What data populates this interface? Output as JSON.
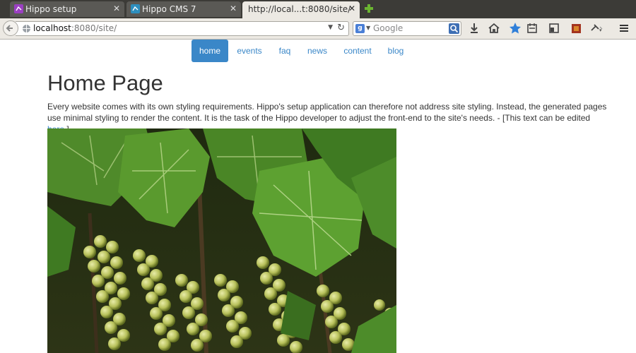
{
  "browser": {
    "tabs": [
      {
        "title": "Hippo setup",
        "active": false
      },
      {
        "title": "Hippo CMS 7",
        "active": false
      },
      {
        "title": "http://local...t:8080/site/",
        "active": true
      }
    ],
    "url_host": "localhost",
    "url_rest": ":8080/site/",
    "search_engine": "g-icon",
    "search_placeholder": "Google"
  },
  "site": {
    "nav": [
      {
        "label": "home",
        "active": true
      },
      {
        "label": "events",
        "active": false
      },
      {
        "label": "faq",
        "active": false
      },
      {
        "label": "news",
        "active": false
      },
      {
        "label": "content",
        "active": false
      },
      {
        "label": "blog",
        "active": false
      }
    ],
    "heading": "Home Page",
    "intro": "Every website comes with its own styling requirements. Hippo's setup application can therefore not address site styling. Instead, the generated pages use minimal styling to render the content. It is the task of the Hippo developer to adjust the front-end to the site's needs. - [This text can be edited ",
    "intro_link": "here",
    "intro_end": ".]",
    "image": "grape-vine-photo"
  },
  "colors": {
    "accent": "#3a87c8",
    "tabbar": "#3c3b37",
    "toolbar": "#ece9e3"
  }
}
